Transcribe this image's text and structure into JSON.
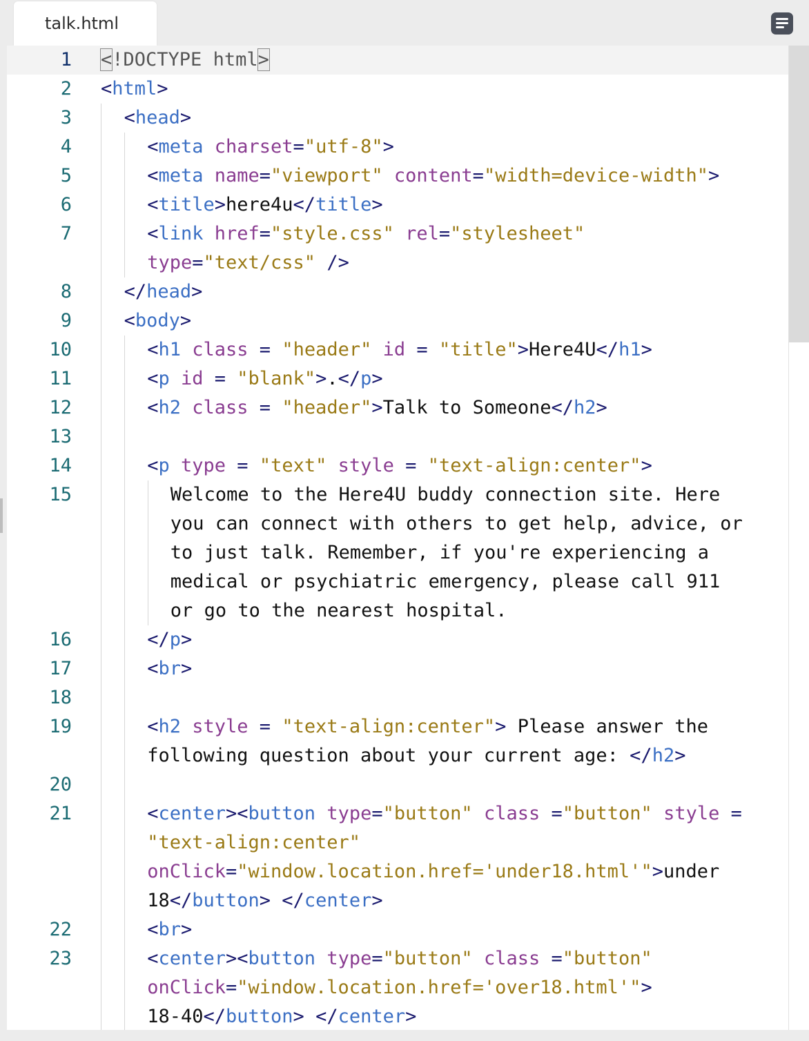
{
  "tab": {
    "filename": "talk.html"
  },
  "menu_icon": "hamburger-menu-icon",
  "lines": [
    {
      "n": "1",
      "indent": 0,
      "active": true,
      "tokens": [
        [
          "doc",
          "<!DOCTYPE html>"
        ]
      ]
    },
    {
      "n": "2",
      "indent": 0,
      "tokens": [
        [
          "pu",
          "<"
        ],
        [
          "tag",
          "html"
        ],
        [
          "pu",
          ">"
        ]
      ]
    },
    {
      "n": "3",
      "indent": 1,
      "tokens": [
        [
          "pu",
          "<"
        ],
        [
          "tag",
          "head"
        ],
        [
          "pu",
          ">"
        ]
      ]
    },
    {
      "n": "4",
      "indent": 2,
      "tokens": [
        [
          "pu",
          "<"
        ],
        [
          "tag",
          "meta"
        ],
        [
          "txt",
          " "
        ],
        [
          "attr",
          "charset"
        ],
        [
          "pu",
          "="
        ],
        [
          "str",
          "\"utf-8\""
        ],
        [
          "pu",
          ">"
        ]
      ]
    },
    {
      "n": "5",
      "indent": 2,
      "tokens": [
        [
          "pu",
          "<"
        ],
        [
          "tag",
          "meta"
        ],
        [
          "txt",
          " "
        ],
        [
          "attr",
          "name"
        ],
        [
          "pu",
          "="
        ],
        [
          "str",
          "\"viewport\""
        ],
        [
          "txt",
          " "
        ],
        [
          "attr",
          "content"
        ],
        [
          "pu",
          "="
        ],
        [
          "str",
          "\"width=device-width\""
        ],
        [
          "pu",
          ">"
        ]
      ]
    },
    {
      "n": "6",
      "indent": 2,
      "tokens": [
        [
          "pu",
          "<"
        ],
        [
          "tag",
          "title"
        ],
        [
          "pu",
          ">"
        ],
        [
          "txt",
          "here4u"
        ],
        [
          "pu",
          "</"
        ],
        [
          "tag",
          "title"
        ],
        [
          "pu",
          ">"
        ]
      ]
    },
    {
      "n": "7",
      "indent": 2,
      "tokens": [
        [
          "pu",
          "<"
        ],
        [
          "tag",
          "link"
        ],
        [
          "txt",
          " "
        ],
        [
          "attr",
          "href"
        ],
        [
          "pu",
          "="
        ],
        [
          "str",
          "\"style.css\""
        ],
        [
          "txt",
          " "
        ],
        [
          "attr",
          "rel"
        ],
        [
          "pu",
          "="
        ],
        [
          "str",
          "\"stylesheet\""
        ]
      ]
    },
    {
      "n": "",
      "indent": 2,
      "tokens": [
        [
          "attr",
          "type"
        ],
        [
          "pu",
          "="
        ],
        [
          "str",
          "\"text/css\""
        ],
        [
          "txt",
          " "
        ],
        [
          "pu",
          "/>"
        ]
      ]
    },
    {
      "n": "8",
      "indent": 1,
      "tokens": [
        [
          "pu",
          "</"
        ],
        [
          "tag",
          "head"
        ],
        [
          "pu",
          ">"
        ]
      ]
    },
    {
      "n": "9",
      "indent": 1,
      "tokens": [
        [
          "pu",
          "<"
        ],
        [
          "tag",
          "body"
        ],
        [
          "pu",
          ">"
        ]
      ]
    },
    {
      "n": "10",
      "indent": 2,
      "tokens": [
        [
          "pu",
          "<"
        ],
        [
          "tag",
          "h1"
        ],
        [
          "txt",
          " "
        ],
        [
          "attr",
          "class"
        ],
        [
          "txt",
          " "
        ],
        [
          "pu",
          "="
        ],
        [
          "txt",
          " "
        ],
        [
          "str",
          "\"header\""
        ],
        [
          "txt",
          " "
        ],
        [
          "attr",
          "id"
        ],
        [
          "txt",
          " "
        ],
        [
          "pu",
          "="
        ],
        [
          "txt",
          " "
        ],
        [
          "str",
          "\"title\""
        ],
        [
          "pu",
          ">"
        ],
        [
          "txt",
          "Here4U"
        ],
        [
          "pu",
          "</"
        ],
        [
          "tag",
          "h1"
        ],
        [
          "pu",
          ">"
        ]
      ]
    },
    {
      "n": "11",
      "indent": 2,
      "tokens": [
        [
          "pu",
          "<"
        ],
        [
          "tag",
          "p"
        ],
        [
          "txt",
          " "
        ],
        [
          "attr",
          "id"
        ],
        [
          "txt",
          " "
        ],
        [
          "pu",
          "="
        ],
        [
          "txt",
          " "
        ],
        [
          "str",
          "\"blank\""
        ],
        [
          "pu",
          ">"
        ],
        [
          "txt",
          "."
        ],
        [
          "pu",
          "</"
        ],
        [
          "tag",
          "p"
        ],
        [
          "pu",
          ">"
        ]
      ]
    },
    {
      "n": "12",
      "indent": 2,
      "tokens": [
        [
          "pu",
          "<"
        ],
        [
          "tag",
          "h2"
        ],
        [
          "txt",
          " "
        ],
        [
          "attr",
          "class"
        ],
        [
          "txt",
          " "
        ],
        [
          "pu",
          "="
        ],
        [
          "txt",
          " "
        ],
        [
          "str",
          "\"header\""
        ],
        [
          "pu",
          ">"
        ],
        [
          "txt",
          "Talk to Someone"
        ],
        [
          "pu",
          "</"
        ],
        [
          "tag",
          "h2"
        ],
        [
          "pu",
          ">"
        ]
      ]
    },
    {
      "n": "13",
      "indent": 2,
      "tokens": []
    },
    {
      "n": "14",
      "indent": 2,
      "tokens": [
        [
          "pu",
          "<"
        ],
        [
          "tag",
          "p"
        ],
        [
          "txt",
          " "
        ],
        [
          "attr",
          "type"
        ],
        [
          "txt",
          " "
        ],
        [
          "pu",
          "="
        ],
        [
          "txt",
          " "
        ],
        [
          "str",
          "\"text\""
        ],
        [
          "txt",
          " "
        ],
        [
          "attr",
          "style"
        ],
        [
          "txt",
          " "
        ],
        [
          "pu",
          "="
        ],
        [
          "txt",
          " "
        ],
        [
          "str",
          "\"text-align:center\""
        ],
        [
          "pu",
          ">"
        ]
      ]
    },
    {
      "n": "15",
      "indent": 3,
      "tokens": [
        [
          "txt",
          "Welcome to the Here4U buddy connection site. Here"
        ]
      ]
    },
    {
      "n": "",
      "indent": 3,
      "tokens": [
        [
          "txt",
          "you can connect with others to get help, advice, or"
        ]
      ]
    },
    {
      "n": "",
      "indent": 3,
      "tokens": [
        [
          "txt",
          "to just talk. Remember, if you're experiencing a"
        ]
      ]
    },
    {
      "n": "",
      "indent": 3,
      "tokens": [
        [
          "txt",
          "medical or psychiatric emergency, please call 911"
        ]
      ]
    },
    {
      "n": "",
      "indent": 3,
      "tokens": [
        [
          "txt",
          "or go to the nearest hospital."
        ]
      ]
    },
    {
      "n": "16",
      "indent": 2,
      "tokens": [
        [
          "pu",
          "</"
        ],
        [
          "tag",
          "p"
        ],
        [
          "pu",
          ">"
        ]
      ]
    },
    {
      "n": "17",
      "indent": 2,
      "tokens": [
        [
          "pu",
          "<"
        ],
        [
          "tag",
          "br"
        ],
        [
          "pu",
          ">"
        ]
      ]
    },
    {
      "n": "18",
      "indent": 2,
      "tokens": []
    },
    {
      "n": "19",
      "indent": 2,
      "tokens": [
        [
          "pu",
          "<"
        ],
        [
          "tag",
          "h2"
        ],
        [
          "txt",
          " "
        ],
        [
          "attr",
          "style"
        ],
        [
          "txt",
          " "
        ],
        [
          "pu",
          "="
        ],
        [
          "txt",
          " "
        ],
        [
          "str",
          "\"text-align:center\""
        ],
        [
          "pu",
          ">"
        ],
        [
          "txt",
          " Please answer the"
        ]
      ]
    },
    {
      "n": "",
      "indent": 2,
      "tokens": [
        [
          "txt",
          "following question about your current age: "
        ],
        [
          "pu",
          "</"
        ],
        [
          "tag",
          "h2"
        ],
        [
          "pu",
          ">"
        ]
      ]
    },
    {
      "n": "20",
      "indent": 2,
      "tokens": []
    },
    {
      "n": "21",
      "indent": 2,
      "tokens": [
        [
          "pu",
          "<"
        ],
        [
          "tag",
          "center"
        ],
        [
          "pu",
          "><"
        ],
        [
          "tag",
          "button"
        ],
        [
          "txt",
          " "
        ],
        [
          "attr",
          "type"
        ],
        [
          "pu",
          "="
        ],
        [
          "str",
          "\"button\""
        ],
        [
          "txt",
          " "
        ],
        [
          "attr",
          "class"
        ],
        [
          "txt",
          " "
        ],
        [
          "pu",
          "="
        ],
        [
          "str",
          "\"button\""
        ],
        [
          "txt",
          " "
        ],
        [
          "attr",
          "style"
        ],
        [
          "txt",
          " "
        ],
        [
          "pu",
          "="
        ]
      ]
    },
    {
      "n": "",
      "indent": 2,
      "tokens": [
        [
          "str",
          "\"text-align:center\""
        ]
      ]
    },
    {
      "n": "",
      "indent": 2,
      "tokens": [
        [
          "attr",
          "onClick"
        ],
        [
          "pu",
          "="
        ],
        [
          "str",
          "\"window.location.href='under18.html'\""
        ],
        [
          "pu",
          ">"
        ],
        [
          "txt",
          "under"
        ]
      ]
    },
    {
      "n": "",
      "indent": 2,
      "tokens": [
        [
          "txt",
          "18"
        ],
        [
          "pu",
          "</"
        ],
        [
          "tag",
          "button"
        ],
        [
          "pu",
          ">"
        ],
        [
          "txt",
          " "
        ],
        [
          "pu",
          "</"
        ],
        [
          "tag",
          "center"
        ],
        [
          "pu",
          ">"
        ]
      ]
    },
    {
      "n": "22",
      "indent": 2,
      "tokens": [
        [
          "pu",
          "<"
        ],
        [
          "tag",
          "br"
        ],
        [
          "pu",
          ">"
        ]
      ]
    },
    {
      "n": "23",
      "indent": 2,
      "tokens": [
        [
          "pu",
          "<"
        ],
        [
          "tag",
          "center"
        ],
        [
          "pu",
          "><"
        ],
        [
          "tag",
          "button"
        ],
        [
          "txt",
          " "
        ],
        [
          "attr",
          "type"
        ],
        [
          "pu",
          "="
        ],
        [
          "str",
          "\"button\""
        ],
        [
          "txt",
          " "
        ],
        [
          "attr",
          "class"
        ],
        [
          "txt",
          " "
        ],
        [
          "pu",
          "="
        ],
        [
          "str",
          "\"button\""
        ]
      ]
    },
    {
      "n": "",
      "indent": 2,
      "tokens": [
        [
          "attr",
          "onClick"
        ],
        [
          "pu",
          "="
        ],
        [
          "str",
          "\"window.location.href='over18.html'\""
        ],
        [
          "pu",
          ">"
        ]
      ]
    },
    {
      "n": "",
      "indent": 2,
      "tokens": [
        [
          "txt",
          "18-40"
        ],
        [
          "pu",
          "</"
        ],
        [
          "tag",
          "button"
        ],
        [
          "pu",
          ">"
        ],
        [
          "txt",
          " "
        ],
        [
          "pu",
          "</"
        ],
        [
          "tag",
          "center"
        ],
        [
          "pu",
          ">"
        ]
      ]
    }
  ]
}
